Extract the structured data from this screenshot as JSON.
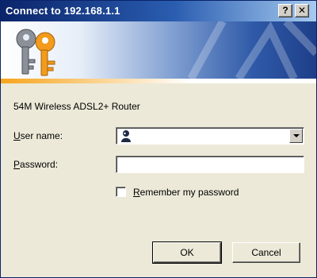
{
  "window": {
    "title": "Connect to 192.168.1.1",
    "help_button": "?",
    "close_button": "✕"
  },
  "banner": {
    "icon": "keys-icon",
    "accent_color": "#f7a41b",
    "brand_color": "#2f5aa8"
  },
  "dialog": {
    "device_name": "54M Wireless ADSL2+ Router",
    "username": {
      "label_underline": "U",
      "label_rest": "ser name:",
      "value": "",
      "icon": "user-icon"
    },
    "password": {
      "label_underline": "P",
      "label_rest": "assword:",
      "value": ""
    },
    "remember": {
      "label_underline": "R",
      "label_rest": "emember my password",
      "checked": false
    },
    "buttons": {
      "ok": "OK",
      "cancel": "Cancel"
    }
  }
}
